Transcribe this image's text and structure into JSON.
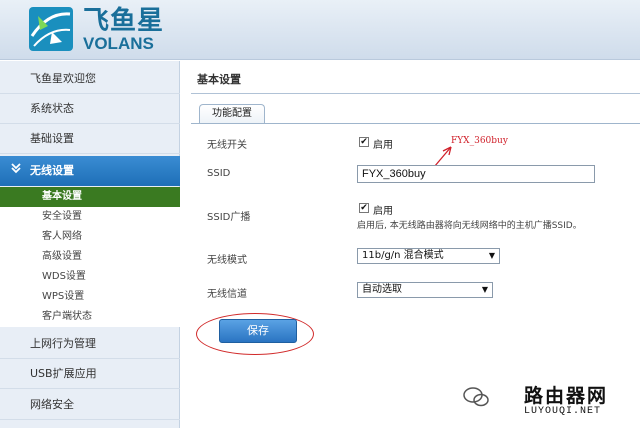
{
  "brand": {
    "name_cn": "飞鱼星",
    "name_en": "VOLANS"
  },
  "sidebar": {
    "items": [
      {
        "label": "飞鱼星欢迎您"
      },
      {
        "label": "系统状态"
      },
      {
        "label": "基础设置"
      },
      {
        "label": "无线设置"
      },
      {
        "label": "上网行为管理"
      },
      {
        "label": "USB扩展应用"
      },
      {
        "label": "网络安全"
      }
    ],
    "active_icon": "chevrons-down-icon",
    "subitems": [
      {
        "label": "基本设置"
      },
      {
        "label": "安全设置"
      },
      {
        "label": "客人网络"
      },
      {
        "label": "高级设置"
      },
      {
        "label": "WDS设置"
      },
      {
        "label": "WPS设置"
      },
      {
        "label": "客户端状态"
      }
    ]
  },
  "main": {
    "title": "基本设置",
    "tab": "功能配置",
    "fields": {
      "wireless_switch": {
        "label": "无线开关",
        "checkbox_label": "启用",
        "checked": true
      },
      "ssid": {
        "label": "SSID",
        "value": "FYX_360buy"
      },
      "ssid_broadcast": {
        "label": "SSID广播",
        "checkbox_label": "启用",
        "checked": true,
        "hint": "启用后, 本无线路由器将向无线网络中的主机广播SSID。"
      },
      "wireless_mode": {
        "label": "无线模式",
        "value": "11b/g/n 混合模式"
      },
      "wireless_channel": {
        "label": "无线信道",
        "value": "自动选取"
      }
    },
    "annotation": "FYX_360buy",
    "save_label": "保存"
  },
  "watermark": {
    "text": "路由器网",
    "url": "LUYOUQI.NET"
  },
  "colors": {
    "accent": "#2a74c2",
    "active_sub": "#3a7a21",
    "annotation": "#d0202a"
  }
}
